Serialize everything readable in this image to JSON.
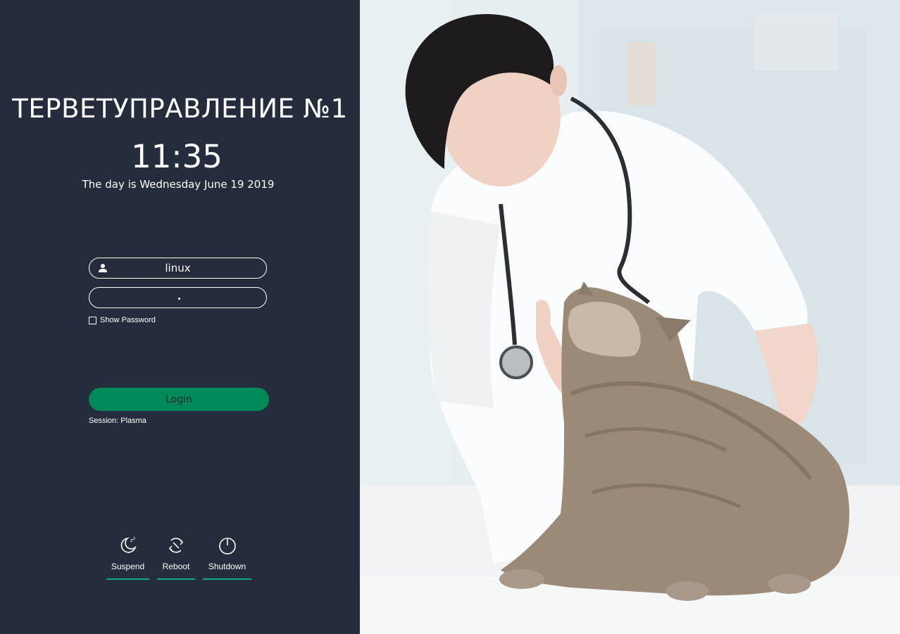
{
  "organization": {
    "title": "ТЕРВЕТУПРАВЛЕНИЕ №1"
  },
  "clock": {
    "time": "11:35",
    "date_line": "The day is Wednesday June 19 2019"
  },
  "login_form": {
    "username": {
      "value": "linux",
      "icon": "user-icon"
    },
    "password": {
      "masked_chars": 1
    },
    "show_password_label": "Show Password",
    "login_label": "Login",
    "session_label": "Session: Plasma"
  },
  "power_actions": [
    {
      "id": "suspend",
      "label": "Suspend",
      "icon": "suspend-icon"
    },
    {
      "id": "reboot",
      "label": "Reboot",
      "icon": "reboot-icon"
    },
    {
      "id": "shutdown",
      "label": "Shutdown",
      "icon": "power-icon"
    }
  ],
  "colors": {
    "panel_bg": "#252d3c",
    "accent_green": "#008a5a",
    "underline_teal": "#13a683",
    "text": "#ffffff"
  }
}
